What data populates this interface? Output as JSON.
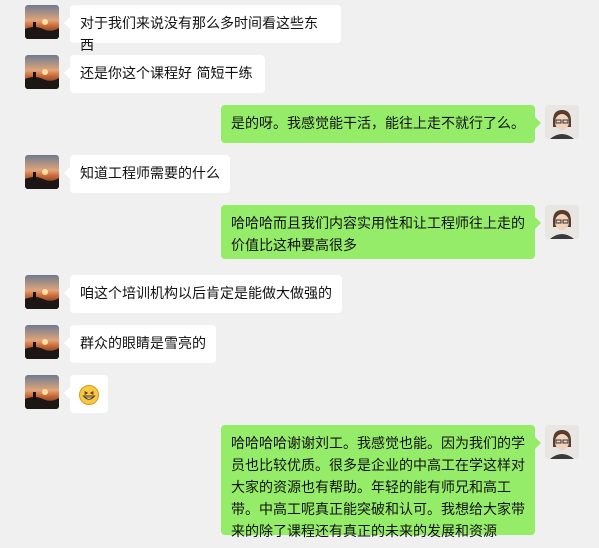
{
  "conversation": {
    "messages": [
      {
        "side": "left",
        "text": "对于我们来说没有那么多时间看这些东西"
      },
      {
        "side": "left",
        "text": "还是你这个课程好 简短干练"
      },
      {
        "side": "right",
        "text": "是的呀。我感觉能干活，能往上走不就行了么。"
      },
      {
        "side": "left",
        "text": "知道工程师需要的什么"
      },
      {
        "side": "right",
        "text": "哈哈哈而且我们内容实用性和让工程师往上走的价值比这种要高很多"
      },
      {
        "side": "left",
        "text": "咱这个培训机构以后肯定是能做大做强的"
      },
      {
        "side": "left",
        "text": "群众的眼睛是雪亮的"
      },
      {
        "side": "left",
        "emoji": "grinning-face-emoji"
      },
      {
        "side": "right",
        "text": "哈哈哈哈谢谢刘工。我感觉也能。因为我们的学员也比较优质。很多是企业的中高工在学这样对大家的资源也有帮助。年轻的能有师兄和高工带。中高工呢真正能突破和认可。我想给大家带来的除了课程还有真正的未来的发展和资源"
      }
    ]
  },
  "colors": {
    "background": "#f0f0f0",
    "incoming_bubble": "#ffffff",
    "outgoing_bubble": "#95ec69"
  }
}
